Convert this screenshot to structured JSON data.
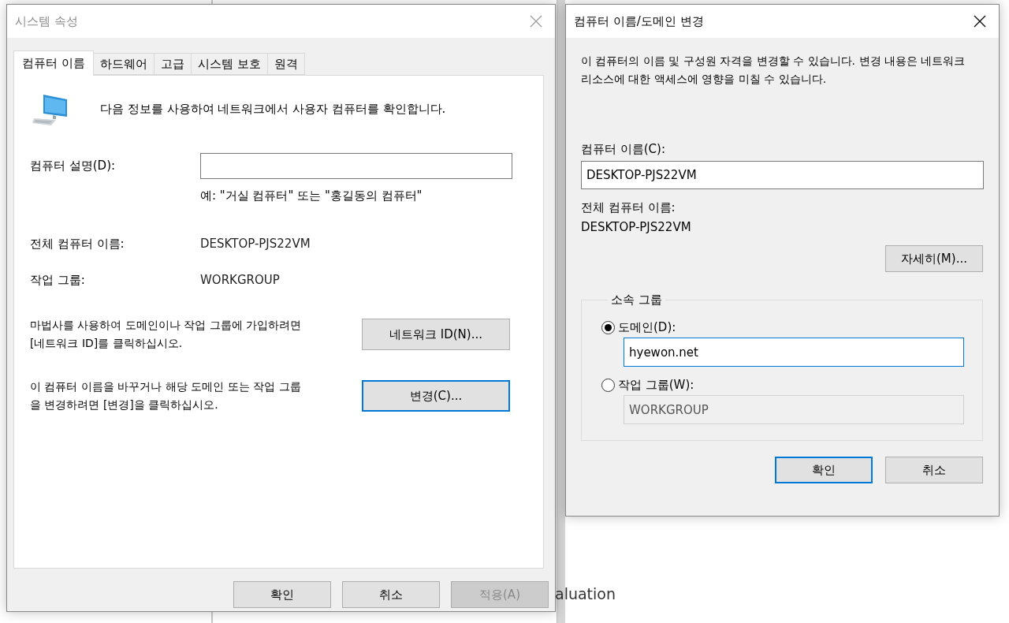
{
  "background_window": {
    "text": "aluation"
  },
  "system_properties": {
    "title": "시스템 속성",
    "active": false,
    "tabs": [
      {
        "label": "컴퓨터 이름",
        "selected": true
      },
      {
        "label": "하드웨어",
        "selected": false
      },
      {
        "label": "고급",
        "selected": false
      },
      {
        "label": "시스템 보호",
        "selected": false
      },
      {
        "label": "원격",
        "selected": false
      }
    ],
    "intro": "다음 정보를 사용하여 네트워크에서 사용자 컴퓨터를 확인합니다.",
    "description_label": "컴퓨터 설명(D):",
    "description_example": "예: \"거실 컴퓨터\" 또는 \"홍길동의 컴퓨터\"",
    "info_rows": [
      {
        "label": "전체 컴퓨터 이름:",
        "value": "DESKTOP-PJS22VM"
      },
      {
        "label": "작업 그룹:",
        "value": "WORKGROUP"
      }
    ],
    "actions": [
      {
        "text": "마법사를 사용하여 도메인이나 작업 그룹에 가입하려면 [네트워크 ID]를 클릭하십시오.",
        "button": "네트워크 ID(N)...",
        "focused": false
      },
      {
        "text": "이 컴퓨터 이름을 바꾸거나 해당 도메인 또는 작업 그룹을 변경하려면 [변경]을 클릭하십시오.",
        "button": "변경(C)...",
        "focused": true
      }
    ],
    "buttons": [
      {
        "label": "확인",
        "disabled": false
      },
      {
        "label": "취소",
        "disabled": false
      },
      {
        "label": "적용(A)",
        "disabled": true
      }
    ]
  },
  "change_dialog": {
    "title": "컴퓨터 이름/도메인 변경",
    "active": true,
    "intro": "이 컴퓨터의 이름 및 구성원 자격을 변경할 수 있습니다. 변경 내용은 네트워크 리소스에 대한 액세스에 영향을 미칠 수 있습니다.",
    "computer_name_label": "컴퓨터 이름(C):",
    "computer_name_value": "DESKTOP-PJS22VM",
    "full_name_label": "전체 컴퓨터 이름:",
    "full_name_value": "DESKTOP-PJS22VM",
    "more_button": "자세히(M)...",
    "member_of": {
      "legend": "소속 그룹",
      "options": [
        {
          "label": "도메인(D):",
          "selected": true,
          "value": "hyewon.net"
        },
        {
          "label": "작업 그룹(W):",
          "selected": false,
          "value": "WORKGROUP"
        }
      ]
    },
    "buttons": [
      {
        "label": "확인",
        "focused": true
      },
      {
        "label": "취소",
        "focused": false
      }
    ]
  }
}
